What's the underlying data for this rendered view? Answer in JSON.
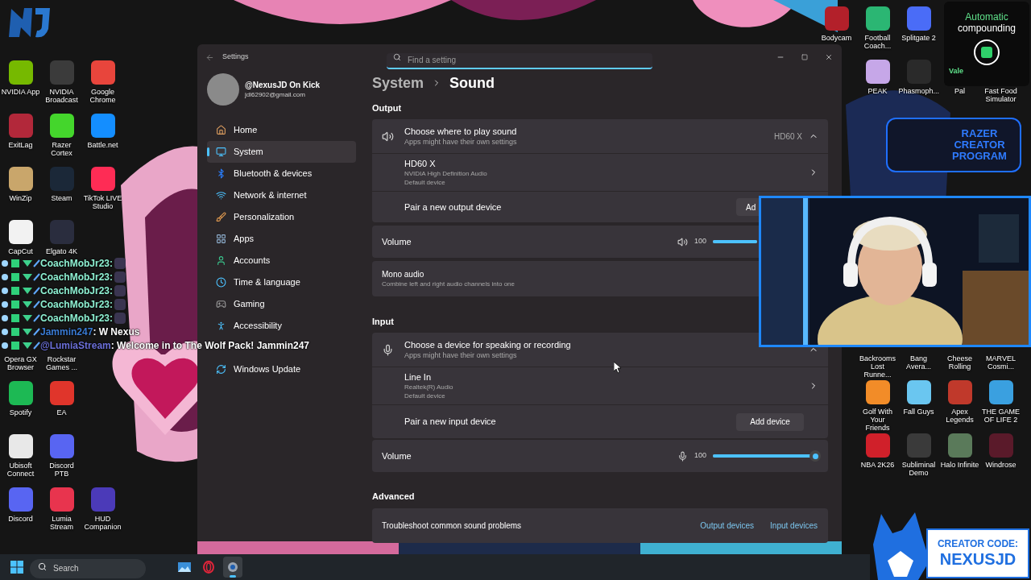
{
  "desktop": {
    "left_upper_rows": [
      [
        {
          "label": "NVIDIA App",
          "color": "#76b900"
        },
        {
          "label": "NVIDIA Broadcast",
          "color": "#3b3b3b"
        },
        {
          "label": "Google Chrome",
          "color": "#e8453c"
        }
      ],
      [
        {
          "label": "ExitLag",
          "color": "#b2283a"
        },
        {
          "label": "Razer Cortex",
          "color": "#44d62c"
        },
        {
          "label": "Battle.net",
          "color": "#148eff"
        }
      ],
      [
        {
          "label": "WinZip",
          "color": "#c9a66b"
        },
        {
          "label": "Steam",
          "color": "#1b2838"
        },
        {
          "label": "TikTok LIVE Studio",
          "color": "#fe2c55"
        }
      ],
      [
        {
          "label": "CapCut",
          "color": "#f2f2f2"
        },
        {
          "label": "Elgato 4K",
          "color": "#2a2d3e"
        }
      ]
    ],
    "left_lower_rows": [
      [
        {
          "label": "Opera GX Browser"
        },
        {
          "label": "Rockstar Games ..."
        }
      ],
      [
        {
          "label": "Spotify",
          "color": "#1db954"
        },
        {
          "label": "EA",
          "color": "#e0352b"
        }
      ],
      [
        {
          "label": "Ubisoft Connect",
          "color": "#e8e8e8"
        },
        {
          "label": "Discord PTB",
          "color": "#5865f2"
        }
      ],
      [
        {
          "label": "Discord",
          "color": "#5865f2"
        },
        {
          "label": "Lumia Stream",
          "color": "#e8344e"
        },
        {
          "label": "HUD Companion",
          "color": "#4b3ab8"
        }
      ]
    ],
    "right_top_rows": [
      [
        {
          "label": "Bodycam",
          "color": "#b3202a"
        },
        {
          "label": "Football Coach...",
          "color": "#2bb673"
        },
        {
          "label": "Splitgate 2",
          "color": "#4a6cf7"
        }
      ],
      [
        {
          "label": "PEAK",
          "color": "#c6a7e8"
        },
        {
          "label": "Phasmoph...",
          "color": "#2a2a2a"
        },
        {
          "label": "Pal"
        },
        {
          "label": "Fast Food Simulator"
        }
      ]
    ],
    "right_bottom_rows": [
      [
        {
          "label": "Backrooms Lost Runne..."
        },
        {
          "label": "Bang Avera..."
        },
        {
          "label": "Cheese Rolling"
        },
        {
          "label": "MARVEL Cosmi..."
        }
      ],
      [
        {
          "label": "Golf With Your Friends",
          "color": "#f28c28"
        },
        {
          "label": "Fall Guys",
          "color": "#6ac6f0"
        },
        {
          "label": "Apex Legends",
          "color": "#c0392b"
        },
        {
          "label": "THE GAME OF LIFE 2",
          "color": "#3aa0e0"
        }
      ],
      [
        {
          "label": "NBA 2K26",
          "color": "#d0202a"
        },
        {
          "label": "Subliminal Demo",
          "color": "#3a3a3a"
        },
        {
          "label": "Halo Infinite",
          "color": "#5a7a5a"
        },
        {
          "label": "Windrose",
          "color": "#5a1a2a"
        }
      ]
    ]
  },
  "settings": {
    "title": "Settings",
    "search": {
      "placeholder": "Find a setting"
    },
    "profile": {
      "name": "@NexusJD On Kick",
      "email": "jdl62902@gmail.com"
    },
    "nav": [
      {
        "label": "Home",
        "selected": false
      },
      {
        "label": "System",
        "selected": true
      },
      {
        "label": "Bluetooth & devices",
        "selected": false
      },
      {
        "label": "Network & internet",
        "selected": false
      },
      {
        "label": "Personalization",
        "selected": false
      },
      {
        "label": "Apps",
        "selected": false
      },
      {
        "label": "Accounts",
        "selected": false
      },
      {
        "label": "Time & language",
        "selected": false
      },
      {
        "label": "Gaming",
        "selected": false
      },
      {
        "label": "Accessibility",
        "selected": false
      }
    ],
    "update_item": {
      "label": "Windows Update",
      "selected": false
    },
    "breadcrumb": [
      "System",
      "Sound"
    ],
    "output": {
      "heading": "Output",
      "chooser": {
        "title": "Choose where to play sound",
        "subtitle": "Apps might have their own settings",
        "value": "HD60 X",
        "expanded": true
      },
      "device": {
        "name": "HD60 X",
        "driver": "NVIDIA High Definition Audio",
        "status": "Default device"
      },
      "pair": {
        "label": "Pair a new output device",
        "button": "Ad"
      },
      "volume": {
        "label": "Volume",
        "reading": "100",
        "level": 1
      },
      "mono": {
        "title": "Mono audio",
        "subtitle": "Combine left and right audio channels into one"
      }
    },
    "input": {
      "heading": "Input",
      "chooser": {
        "title": "Choose a device for speaking or recording",
        "subtitle": "Apps might have their own settings",
        "expanded": true
      },
      "device": {
        "name": "Line In",
        "driver": "Realtek(R) Audio",
        "status": "Default device"
      },
      "pair": {
        "label": "Pair a new input device",
        "button": "Add device"
      },
      "volume": {
        "label": "Volume",
        "reading": "100",
        "level": 1
      }
    },
    "advanced": {
      "heading": "Advanced",
      "troubleshoot": {
        "label": "Troubleshoot common sound problems",
        "links": [
          "Output devices",
          "Input devices"
        ]
      }
    }
  },
  "chat": [
    {
      "user": "CoachMobJr23:",
      "color": "#8ef0d2"
    },
    {
      "user": "CoachMobJr23:",
      "color": "#8ef0d2"
    },
    {
      "user": "CoachMobJr23:",
      "color": "#8ef0d2"
    },
    {
      "user": "CoachMobJr23:",
      "color": "#8ef0d2"
    },
    {
      "user": "CoachMobJr23:",
      "color": "#8ef0d2"
    },
    {
      "user": "Jammin247",
      "color": "#3a7bd5",
      "message": ": W Nexus"
    },
    {
      "user": "@LumiaStream",
      "color": "#6b6fd8",
      "message": ": Welcome in to The Wolf Pack! Jammin247"
    }
  ],
  "ad": {
    "headline": "Automatic",
    "subline": "compounding",
    "brand": "Vale"
  },
  "razer_overlay": {
    "text": "RAZER CREATOR PROGRAM"
  },
  "creator_code": {
    "label": "CREATOR CODE:",
    "code": "NEXUSJD"
  },
  "taskbar": {
    "search": {
      "placeholder": "Search"
    },
    "apps": [
      {
        "selected": false
      },
      {
        "selected": false
      },
      {
        "selected": true
      }
    ]
  }
}
